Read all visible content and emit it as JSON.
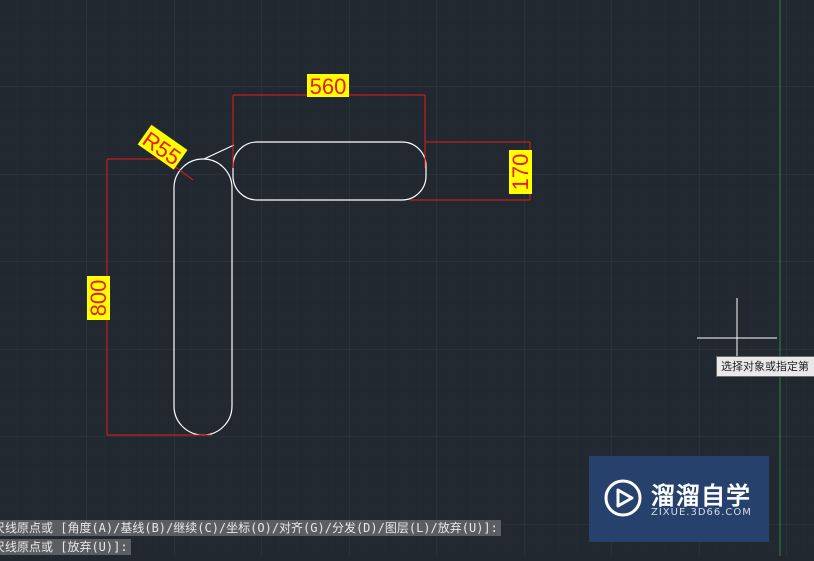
{
  "drawing": {
    "dimensions": {
      "top": "560",
      "right": "170",
      "left": "800",
      "radius": "R55"
    }
  },
  "tooltip": {
    "text": "选择对象或指定第"
  },
  "command_history": [
    "尺线原点或 [角度(A)/基线(B)/继续(C)/坐标(O)/对齐(G)/分发(D)/图层(L)/放弃(U)]:",
    "尺线原点或 [放弃(U)]:"
  ],
  "watermark": {
    "title": "溜溜自学",
    "subtitle": "ZIXUE.3D66.COM",
    "icon": "play-logo-icon"
  },
  "colors": {
    "background": "#212830",
    "grid": "#2f3640",
    "geometry": "#ffffff",
    "dimension": "#e81c1c",
    "label_bg": "#ffff00",
    "axis": "#2f7f3f"
  }
}
